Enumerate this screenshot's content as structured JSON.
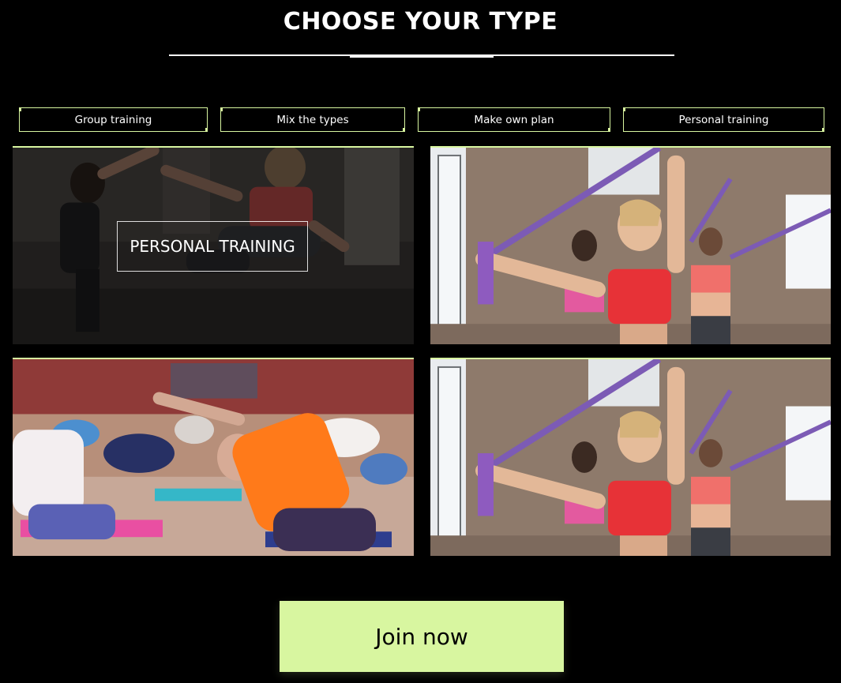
{
  "header": {
    "title": "CHOOSE YOUR TYPE"
  },
  "filters": [
    {
      "label": "Group training"
    },
    {
      "label": "Mix the types"
    },
    {
      "label": "Make own plan"
    },
    {
      "label": "Personal training"
    }
  ],
  "cards": [
    {
      "label": "PERSONAL TRAINING",
      "image": "high-five-workout-photo"
    },
    {
      "image": "resistance-band-class-photo"
    },
    {
      "image": "group-yoga-class-photo"
    },
    {
      "image": "resistance-band-class-photo"
    }
  ],
  "cta": {
    "join_label": "Join now"
  },
  "colors": {
    "background": "#000000",
    "accent": "#d8f6a0",
    "text": "#ffffff"
  }
}
